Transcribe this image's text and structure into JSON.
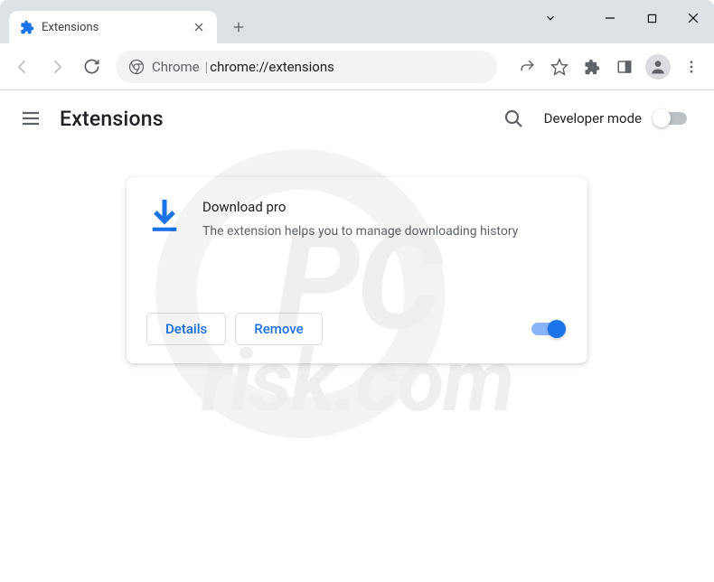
{
  "tab": {
    "title": "Extensions"
  },
  "omnibox": {
    "prefix": "Chrome",
    "url": "chrome://extensions"
  },
  "header": {
    "title": "Extensions",
    "dev_mode_label": "Developer mode",
    "dev_mode_on": false
  },
  "extension": {
    "name": "Download pro",
    "description": "The extension helps you to manage downloading history",
    "details_label": "Details",
    "remove_label": "Remove",
    "enabled": true
  },
  "watermark": {
    "line1": "PC",
    "line2": "risk.com"
  }
}
